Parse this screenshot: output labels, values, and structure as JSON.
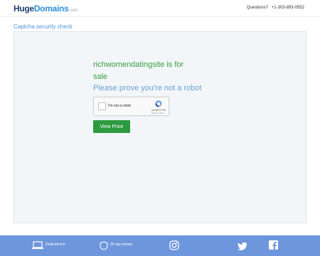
{
  "header": {
    "logo": {
      "huge": "Huge",
      "domains": "Domains",
      "com": ".com"
    },
    "questions_label": "Questions?",
    "phone": "+1-303-893-0552"
  },
  "breadcrumb": "Captcha security check",
  "main": {
    "sale_title": "richwomendatingsite is for sale",
    "robot_prompt": "Please prove you're not a robot",
    "captcha": {
      "checkbox_label": "I'm not a robot",
      "brand": "reCAPTCHA",
      "links": "Privacy - Terms"
    },
    "view_price_label": "View Price"
  },
  "footer": {
    "items": [
      {
        "label": "Dedicated to",
        "sublabel": "",
        "icon": "laptop-icon"
      },
      {
        "label": "30 day money",
        "sublabel": "",
        "icon": "shield-icon"
      },
      {
        "label": "",
        "sublabel": "",
        "icon": "instagram-icon"
      },
      {
        "label": "",
        "sublabel": "",
        "icon": "twitter-icon"
      },
      {
        "label": "",
        "sublabel": "",
        "icon": "facebook-icon"
      }
    ]
  },
  "colors": {
    "accent_green": "#3aa040",
    "button_green": "#2e9a3f",
    "link_blue": "#4a90d9",
    "footer_blue": "#6e96dc",
    "panel_bg": "#f2f6f9"
  }
}
